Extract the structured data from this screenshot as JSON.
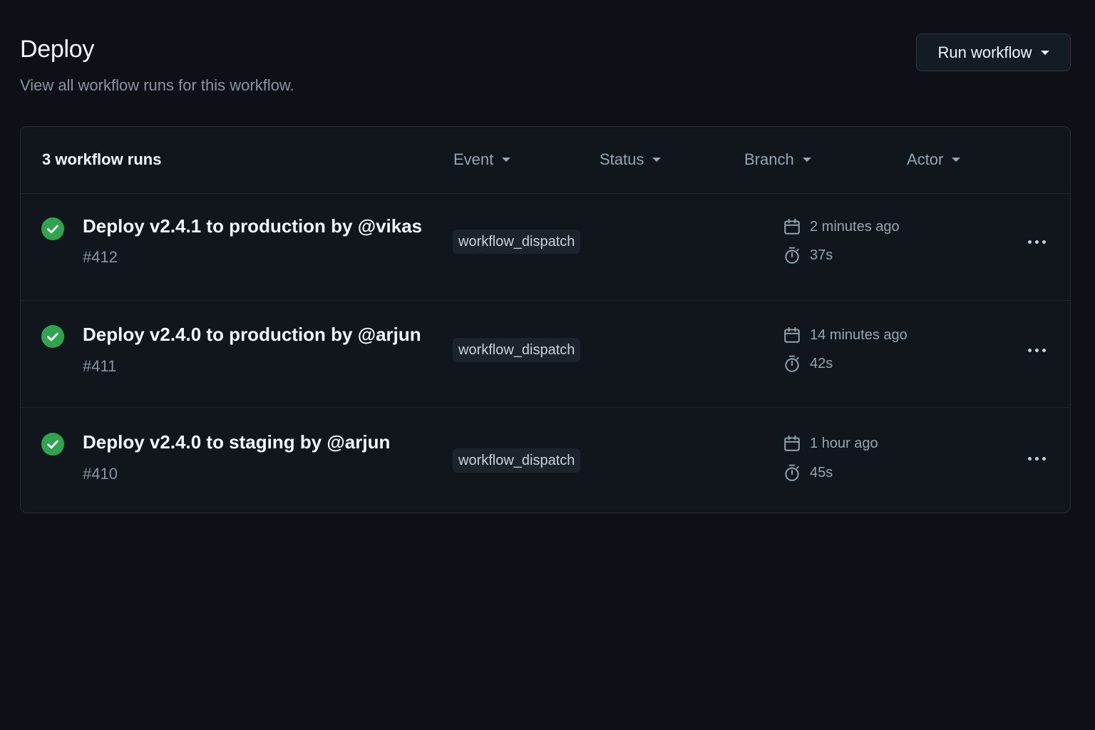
{
  "header": {
    "title": "Deploy",
    "subtitle": "View all workflow runs for this workflow.",
    "run_button_label": "Run workflow"
  },
  "list": {
    "count_label": "3 workflow runs",
    "filters": [
      {
        "label": "Event"
      },
      {
        "label": "Status"
      },
      {
        "label": "Branch"
      },
      {
        "label": "Actor"
      }
    ],
    "runs": [
      {
        "title": "Deploy v2.4.1 to production by @vikas",
        "number": "#412",
        "event": "workflow_dispatch",
        "time": "2 minutes ago",
        "duration": "37s",
        "status": "success"
      },
      {
        "title": "Deploy v2.4.0 to production by @arjun",
        "number": "#411",
        "event": "workflow_dispatch",
        "time": "14 minutes ago",
        "duration": "42s",
        "status": "success"
      },
      {
        "title": "Deploy v2.4.0 to staging by @arjun",
        "number": "#410",
        "event": "workflow_dispatch",
        "time": "1 hour ago",
        "duration": "45s",
        "status": "success"
      }
    ]
  },
  "colors": {
    "background": "#0d1117",
    "panel": "#11161d",
    "success": "#2da44e",
    "muted_text": "#8b949e"
  },
  "icons": {
    "status": "check-circle-icon",
    "time": "calendar-icon",
    "duration": "stopwatch-icon",
    "more": "kebab-horizontal-icon",
    "dropdown": "caret-down-icon"
  }
}
